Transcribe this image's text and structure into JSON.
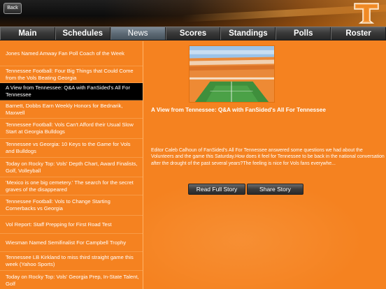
{
  "header": {
    "back_label": "Back"
  },
  "nav": {
    "tabs": [
      {
        "label": "Main",
        "active": false
      },
      {
        "label": "Schedules",
        "active": false
      },
      {
        "label": "News",
        "active": true
      },
      {
        "label": "Scores",
        "active": false
      },
      {
        "label": "Standings",
        "active": false
      },
      {
        "label": "Polls",
        "active": false
      },
      {
        "label": "Roster",
        "active": false
      }
    ]
  },
  "news": {
    "selected_index": 2,
    "items": [
      "Jones Named Amway Fan Poll Coach of the Week",
      "Tennessee Football: Four Big Things that Could Come from the Vols Beating Georgia",
      "A View from Tennessee: Q&A with FanSided's All For Tennessee",
      "Barnett, Dobbs Earn Weekly Honors for Bednarik, Maxwell",
      "Tennessee Football: Vols Can't Afford their Usual Slow Start at Georgia Bulldogs",
      "Tennessee vs Georgia: 10 Keys to the Game for Vols and Bulldogs",
      "Today on Rocky Top: Vols' Depth Chart, Award Finalists, Golf, Volleyball",
      "'Mexico is one big cemetery.' The search for the secret graves of the disappeared",
      "Tennessee Football: Vols to Change Starting Cornerbacks vs Georgia",
      "Vol Report: Staff Prepping for First Road Test",
      "Wiesman Named Semifinalist For Campbell Trophy",
      "Tennessee LB Kirkland to miss third straight game this week (Yahoo Sports)",
      "Today on Rocky Top: Vols' Georgia Prep, In-State Talent, Golf"
    ]
  },
  "article": {
    "title": "A View from Tennessee: Q&A with FanSided's All For Tennessee",
    "body": "Editor Caleb Calhoun of FanSided's All For Tennessee answered some questions we had about the Volunteers and the game this Saturday.How does it feel for Tennessee to be back in the national conversation after the drought of the past several years?The feeling is nice for Vols fans everywhe...",
    "read_label": "Read Full Story",
    "share_label": "Share Story"
  },
  "colors": {
    "brand_orange": "#f58220",
    "selected_row": "#000000",
    "nav_active": "#5d6a75"
  },
  "icons": {
    "logo": "power-t-logo"
  }
}
